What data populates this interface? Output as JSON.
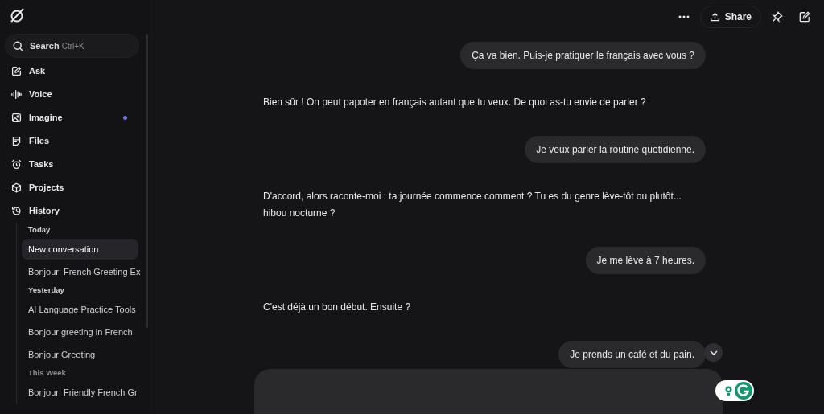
{
  "sidebar": {
    "search": {
      "label": "Search",
      "shortcut": "Ctrl+K"
    },
    "nav": [
      {
        "kind": "ask",
        "label": "Ask",
        "dot": false
      },
      {
        "kind": "voice",
        "label": "Voice",
        "dot": false
      },
      {
        "kind": "imagine",
        "label": "Imagine",
        "dot": true
      },
      {
        "kind": "files",
        "label": "Files",
        "dot": false
      },
      {
        "kind": "tasks",
        "label": "Tasks",
        "dot": false
      },
      {
        "kind": "projects",
        "label": "Projects",
        "dot": false
      },
      {
        "kind": "history",
        "label": "History",
        "dot": false
      }
    ],
    "history": [
      {
        "header": "Today",
        "items": [
          {
            "label": "New conversation",
            "selected": true
          },
          {
            "label": "Bonjour: French Greeting Ex",
            "selected": false
          }
        ]
      },
      {
        "header": "Yesterday",
        "items": [
          {
            "label": "AI Language Practice Tools",
            "selected": false
          },
          {
            "label": "Bonjour greeting in French",
            "selected": false
          },
          {
            "label": "Bonjour Greeting",
            "selected": false
          }
        ]
      },
      {
        "header": "This Week",
        "items": [
          {
            "label": "Bonjour: Friendly French Gr",
            "selected": false
          }
        ]
      }
    ]
  },
  "toolbar": {
    "share": "Share"
  },
  "messages": [
    {
      "kind": "user",
      "text": "Ça va bien. Puis-je pratiquer le français avec vous ?"
    },
    {
      "kind": "assistant",
      "text": "Bien sûr ! On peut papoter en français autant que tu veux. De quoi as-tu envie de parler ?"
    },
    {
      "kind": "user",
      "text": "Je veux parler la routine quotidienne."
    },
    {
      "kind": "assistant",
      "text": "D'accord, alors raconte-moi : ta journée commence comment ? Tu es du genre lève-tôt ou plutôt... hibou nocturne ?"
    },
    {
      "kind": "user",
      "text": "Je me lève à 7 heures."
    },
    {
      "kind": "assistant",
      "text": "C'est déjà un bon début. Ensuite ?"
    },
    {
      "kind": "user",
      "text": "Je prends un café et du pain."
    }
  ]
}
